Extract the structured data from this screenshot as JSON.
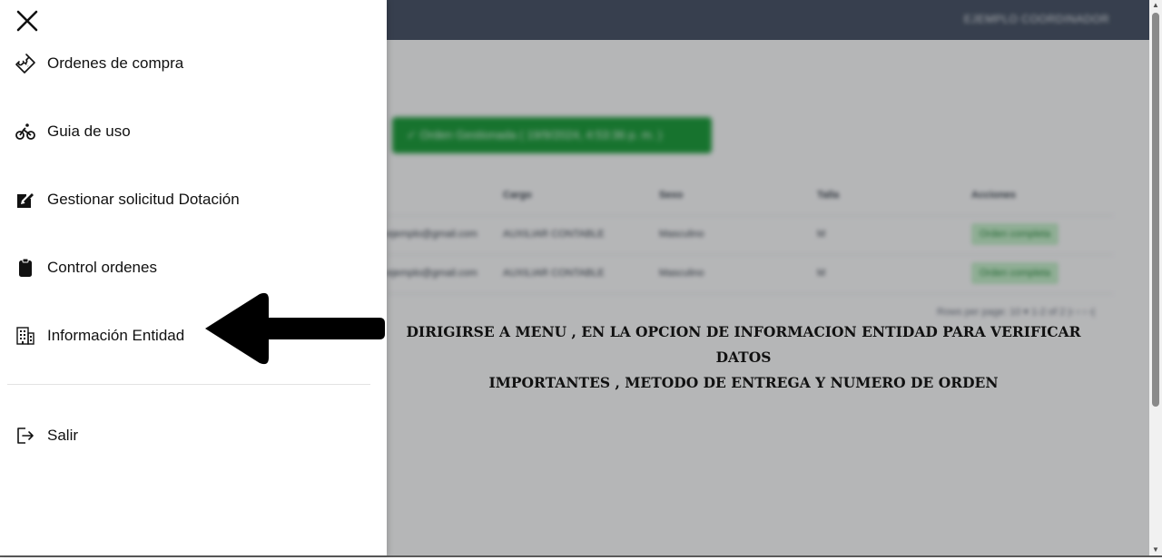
{
  "app": {
    "user_label": "EJEMPLO COORDINADOR",
    "status_button": "✓ Orden Gestionada ( 19/9/2024, 4:53:36 p. m. )",
    "table_headers": [
      "",
      "Cargo",
      "Sexo",
      "Talla",
      "Acciones"
    ],
    "table_rows": [
      [
        "ejemplo@gmail.com",
        "AUXILIAR CONTABLE",
        "Masculino",
        "M",
        "Orden completa"
      ],
      [
        "ejemplo@gmail.com",
        "AUXILIAR CONTABLE",
        "Masculino",
        "M",
        "Orden completa"
      ]
    ],
    "pager": "Rows per page: 10 ▾    1-2 of 2     |‹   ‹   ›   ›|"
  },
  "drawer": {
    "items": [
      {
        "label": "Ordenes de compra",
        "icon": "ticket-icon"
      },
      {
        "label": "Guia de uso",
        "icon": "bike-icon"
      },
      {
        "label": "Gestionar solicitud Dotación",
        "icon": "edit-icon"
      },
      {
        "label": "Control ordenes",
        "icon": "clipboard-icon"
      },
      {
        "label": "Información Entidad",
        "icon": "building-icon"
      },
      {
        "label": "Salir",
        "icon": "logout-icon"
      }
    ]
  },
  "annotation": {
    "line1": "DIRIGIRSE A MENU , EN LA OPCION DE INFORMACION ENTIDAD PARA VERIFICAR DATOS",
    "line2": "IMPORTANTES , METODO DE ENTREGA Y NUMERO DE ORDEN"
  }
}
